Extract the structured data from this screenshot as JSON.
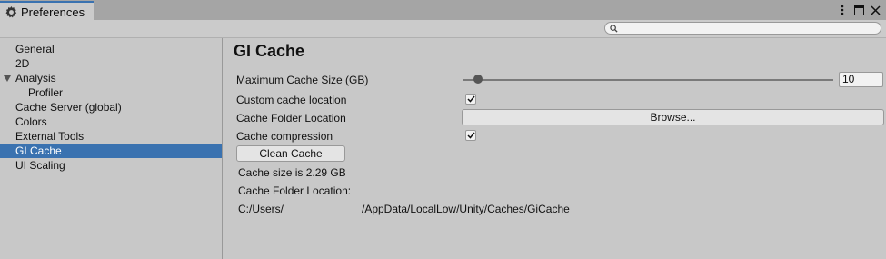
{
  "window": {
    "tab_title": "Preferences",
    "tab_icon": "gear-icon",
    "controls": [
      "more-options-icon",
      "maximize-icon",
      "close-icon"
    ]
  },
  "search": {
    "placeholder": "",
    "value": ""
  },
  "sidebar": {
    "items": [
      {
        "label": "General",
        "selected": false,
        "indent": 0
      },
      {
        "label": "2D",
        "selected": false,
        "indent": 0
      },
      {
        "label": "Analysis",
        "selected": false,
        "indent": 0,
        "expanded": true
      },
      {
        "label": "Profiler",
        "selected": false,
        "indent": 1
      },
      {
        "label": "Cache Server (global)",
        "selected": false,
        "indent": 0
      },
      {
        "label": "Colors",
        "selected": false,
        "indent": 0
      },
      {
        "label": "External Tools",
        "selected": false,
        "indent": 0
      },
      {
        "label": "GI Cache",
        "selected": true,
        "indent": 0
      },
      {
        "label": "UI Scaling",
        "selected": false,
        "indent": 0
      }
    ],
    "selected_color": "#3a72b0"
  },
  "main": {
    "title": "GI Cache",
    "max_cache": {
      "label": "Maximum Cache Size (GB)",
      "value": "10"
    },
    "custom_location": {
      "label": "Custom cache location",
      "checked": true
    },
    "folder_location": {
      "label": "Cache Folder Location",
      "button_label": "Browse..."
    },
    "compression": {
      "label": "Cache compression",
      "checked": true
    },
    "clean_button_label": "Clean Cache",
    "cache_size_text": "Cache size is 2.29 GB",
    "folder_location_heading": "Cache Folder Location:",
    "path_prefix": "C:/Users/",
    "path_suffix": "/AppData/LocalLow/Unity/Caches/GiCache"
  }
}
